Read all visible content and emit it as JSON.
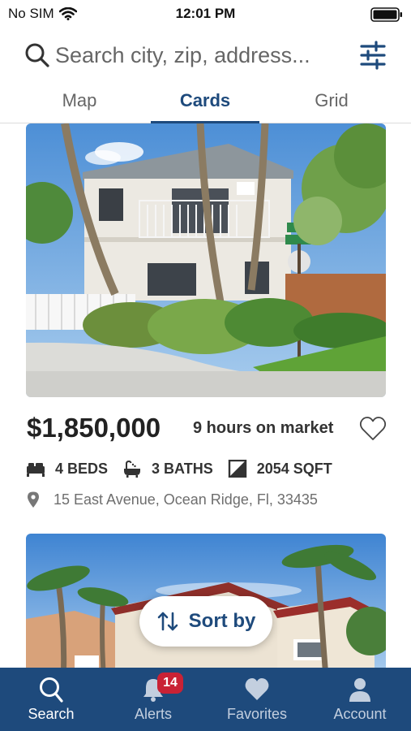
{
  "status_bar": {
    "carrier": "No SIM",
    "time": "12:01 PM"
  },
  "search": {
    "placeholder": "Search city, zip, address..."
  },
  "tabs": [
    {
      "label": "Map",
      "active": false
    },
    {
      "label": "Cards",
      "active": true
    },
    {
      "label": "Grid",
      "active": false
    }
  ],
  "listing": {
    "price": "$1,850,000",
    "market_time": "9 hours on market",
    "beds": "4 BEDS",
    "baths": "3 BATHS",
    "sqft": "2054 SQFT",
    "address": "15 East Avenue, Ocean Ridge, Fl, 33435",
    "favorited": false
  },
  "sort": {
    "label": "Sort by"
  },
  "bottom_nav": [
    {
      "label": "Search",
      "icon": "search-icon",
      "active": true
    },
    {
      "label": "Alerts",
      "icon": "bell-icon",
      "badge": "14"
    },
    {
      "label": "Favorites",
      "icon": "heart-icon"
    },
    {
      "label": "Account",
      "icon": "person-icon"
    }
  ],
  "colors": {
    "brand": "#1e4a7c",
    "badge": "#c92235",
    "muted": "#6e6e6e"
  }
}
